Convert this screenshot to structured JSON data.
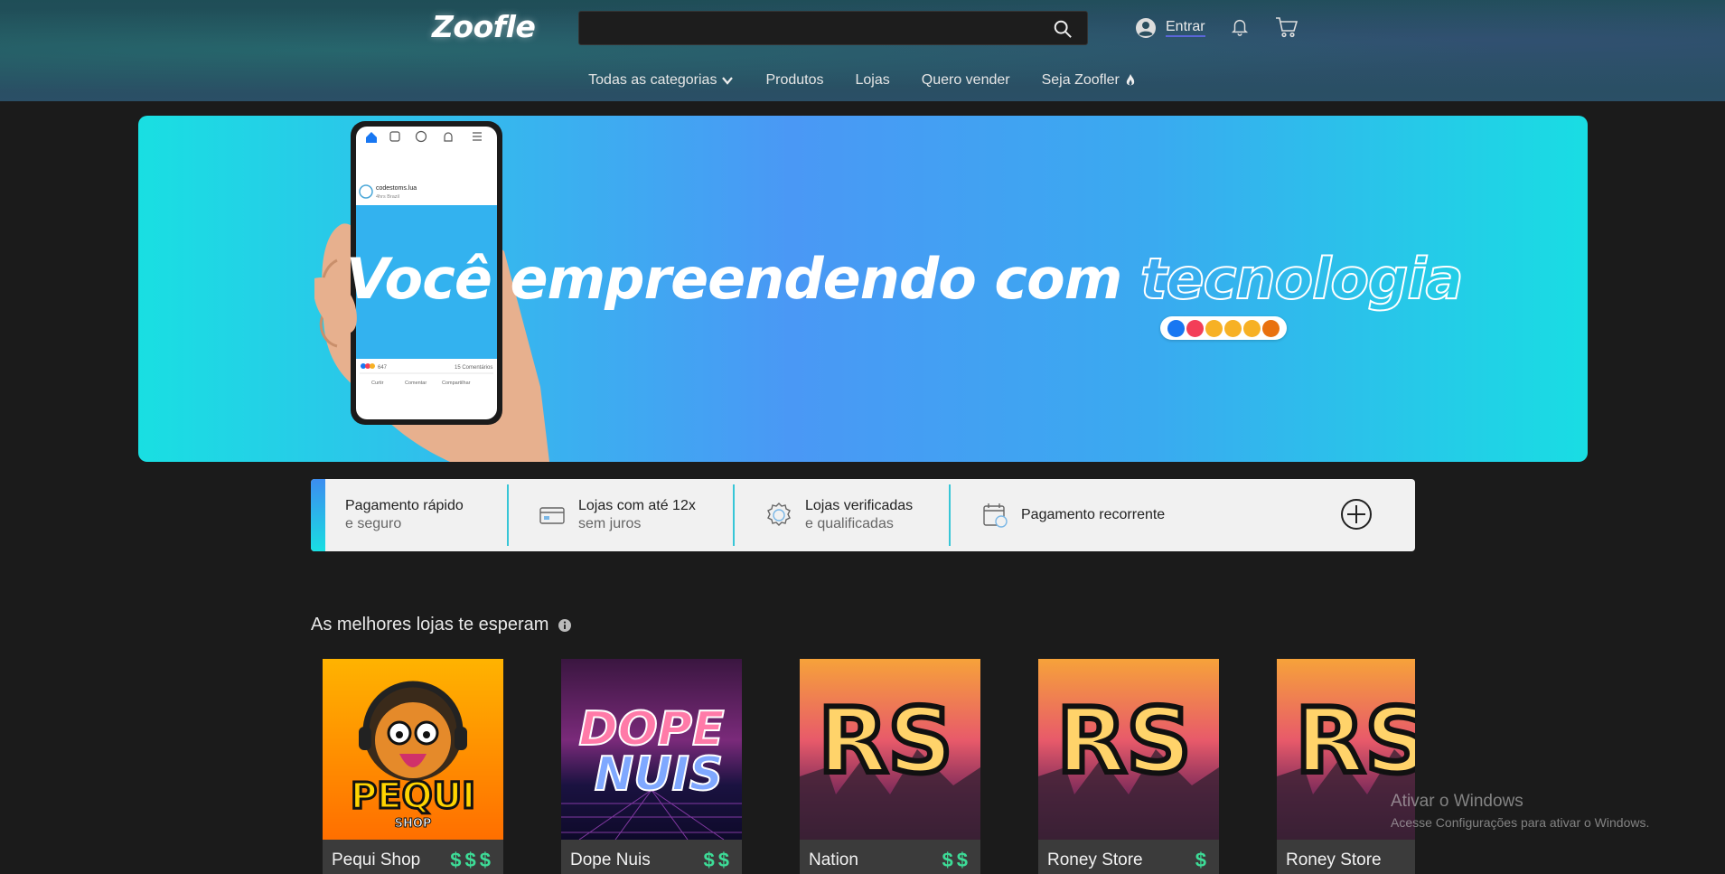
{
  "header": {
    "logo": "Zoofle",
    "search": {
      "placeholder": "",
      "value": ""
    },
    "login_label": "Entrar",
    "nav": [
      {
        "label": "Todas as categorias",
        "icon": "chevron-down-icon"
      },
      {
        "label": "Produtos"
      },
      {
        "label": "Lojas"
      },
      {
        "label": "Quero vender"
      },
      {
        "label": "Seja Zoofler",
        "icon": "flame-icon"
      }
    ]
  },
  "banner": {
    "headline_main": "Você empreendendo com ",
    "headline_outline": "tecnologia",
    "phone": {
      "profile_name": "codestoms.lua",
      "profile_sub": "4hrs Brazil",
      "likes": "647",
      "comments": "15 Comentários",
      "actions": [
        "Curtir",
        "Comentar",
        "Compartilhar"
      ]
    },
    "reactions": [
      "like",
      "love",
      "haha",
      "wow",
      "sad",
      "angry"
    ],
    "colors": {
      "start": "#19dfe2",
      "middle": "#4a98f5",
      "end": "#19dde3"
    }
  },
  "features": [
    {
      "line1": "Pagamento rápido",
      "line2": "e seguro",
      "icon": ""
    },
    {
      "line1": "Lojas com até 12x",
      "line2": "sem juros",
      "icon": "card-icon"
    },
    {
      "line1": "Lojas verificadas",
      "line2": "e qualificadas",
      "icon": "verified-badge-icon"
    },
    {
      "line1": "Pagamento recorrente",
      "line2": "",
      "icon": "calendar-icon"
    }
  ],
  "stores_section": {
    "title": "As melhores lojas te esperam",
    "stores": [
      {
        "name": "Pequi Shop",
        "price_level": "$$$",
        "logo_text": "PEQUI",
        "logo_sub": "SHOP"
      },
      {
        "name": "Dope Nuis",
        "price_level": "$$",
        "logo_text": "DOPE",
        "logo_sub": "NUIS"
      },
      {
        "name": "Nation",
        "price_level": "$$",
        "logo_text": "RS"
      },
      {
        "name": "Roney Store",
        "price_level": "$",
        "logo_text": "RS"
      },
      {
        "name": "Roney Store",
        "price_level": "",
        "logo_text": "RS"
      }
    ]
  },
  "watermark": {
    "line1": "Ativar o Windows",
    "line2": "Acesse Configurações para ativar o Windows."
  },
  "colors": {
    "accent_green": "#3ddc97",
    "accent_cyan": "#37c6d7",
    "background": "#1b1b1b"
  }
}
